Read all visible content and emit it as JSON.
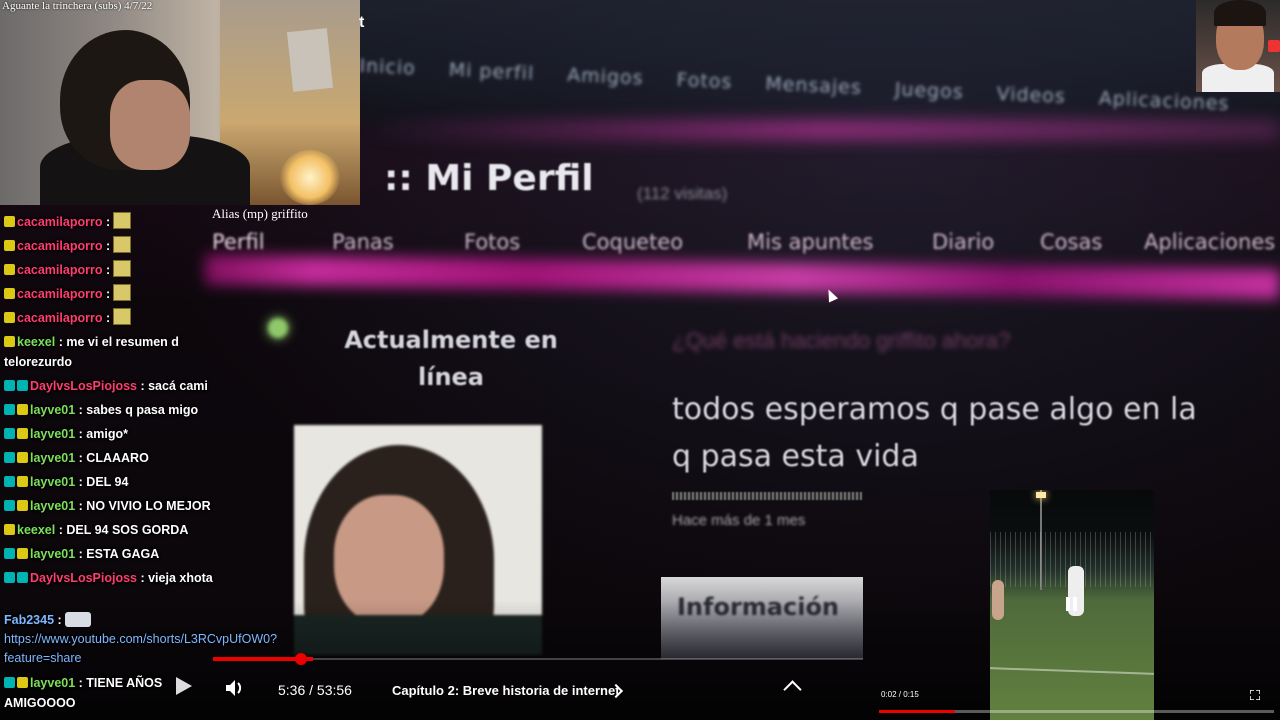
{
  "webcam": {
    "title": "Aguante la trinchera (subs) 4/7/22",
    "alias": "Alias (mp) griffito",
    "corner_letter": "t"
  },
  "website": {
    "top_nav": [
      "Inicio",
      "Mi perfil",
      "Amigos",
      "Fotos",
      "Mensajes",
      "Juegos",
      "Videos",
      "Aplicaciones"
    ],
    "title": ":: Mi Perfil",
    "visits": "(112 visitas)",
    "tabs": [
      "Perfil",
      "Panas",
      "Fotos",
      "Coqueteo",
      "Mis apuntes",
      "Diario",
      "Cosas",
      "Aplicaciones"
    ],
    "online_line1": "Actualmente en",
    "online_line2": "línea",
    "blur_question": "¿Qué está haciendo griffito ahora?",
    "quote_line1": "todos esperamos q pase algo en la",
    "quote_line2": "q pasa esta vida",
    "time_ago": "Hace más de 1 mes",
    "info_button": "Información"
  },
  "chat": [
    {
      "user": "cacamilaporro",
      "text": ":",
      "emote": true,
      "color": "pink",
      "badges": [
        "y"
      ]
    },
    {
      "user": "cacamilaporro",
      "text": ":",
      "emote": true,
      "color": "pink",
      "badges": [
        "y"
      ]
    },
    {
      "user": "cacamilaporro",
      "text": ":",
      "emote": true,
      "color": "pink",
      "badges": [
        "y"
      ]
    },
    {
      "user": "cacamilaporro",
      "text": ":",
      "emote": true,
      "color": "pink",
      "badges": [
        "y"
      ]
    },
    {
      "user": "cacamilaporro",
      "text": ":",
      "emote": true,
      "color": "pink",
      "badges": [
        "y"
      ]
    },
    {
      "user": "keexel",
      "text": ": me vi el resumen d telorezurdo",
      "color": "green",
      "badges": [
        "y"
      ]
    },
    {
      "user": "DaylvsLosPiojoss",
      "text": ": sacá cami",
      "color": "pink",
      "badges": [
        "c",
        "c"
      ]
    },
    {
      "user": "layve01",
      "text": ": sabes q pasa migo",
      "color": "green",
      "badges": [
        "c",
        "y"
      ]
    },
    {
      "user": "layve01",
      "text": ": amigo*",
      "color": "green",
      "badges": [
        "c",
        "y"
      ]
    },
    {
      "user": "layve01",
      "text": ": CLAAARO",
      "color": "green",
      "badges": [
        "c",
        "y"
      ]
    },
    {
      "user": "layve01",
      "text": ": DEL 94",
      "color": "green",
      "badges": [
        "c",
        "y"
      ]
    },
    {
      "user": "layve01",
      "text": ": NO VIVIO LO MEJOR",
      "color": "green",
      "badges": [
        "c",
        "y"
      ]
    },
    {
      "user": "keexel",
      "text": ": DEL 94 SOS GORDA",
      "color": "green",
      "badges": [
        "y"
      ]
    },
    {
      "user": "layve01",
      "text": ": ESTA GAGA",
      "color": "green",
      "badges": [
        "c",
        "y"
      ]
    },
    {
      "user": "DaylvsLosPiojoss",
      "text": ": vieja xhota",
      "color": "pink",
      "badges": [
        "c",
        "c"
      ]
    },
    {
      "user": "Fab2345",
      "text": ":",
      "emote2": true,
      "color": "blue",
      "badges": []
    },
    {
      "user": "",
      "text": "https://www.youtube.com/shorts/L3RCvpUfOW0?feature=share",
      "color": "link",
      "badges": []
    },
    {
      "user": "layve01",
      "text": ": TIENE AÑOS AMIGOOOO",
      "color": "green",
      "badges": [
        "c",
        "y"
      ]
    }
  ],
  "player": {
    "time": "5:36 / 53:56",
    "chapter": "Capítulo 2: Breve historia de internet",
    "progress": 0.104
  },
  "mini_video": {
    "time": "0:02 / 0:15",
    "progress": 0.19
  }
}
